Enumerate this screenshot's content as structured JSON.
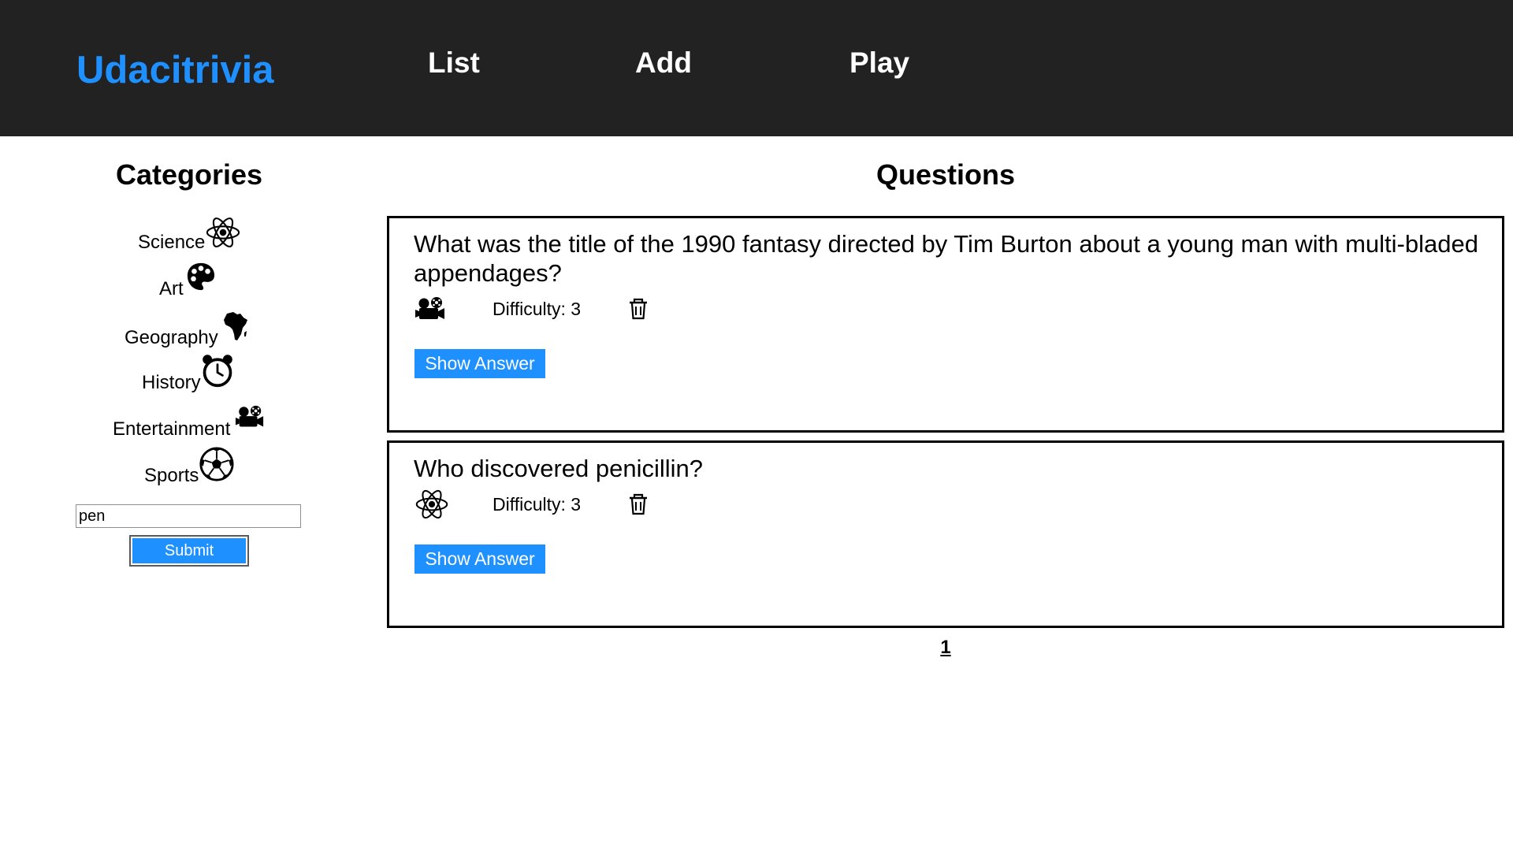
{
  "header": {
    "logo": "Udacitrivia",
    "nav": [
      "List",
      "Add",
      "Play"
    ]
  },
  "categories": {
    "heading": "Categories",
    "items": [
      {
        "label": "Science",
        "icon": "atom-icon"
      },
      {
        "label": "Art",
        "icon": "palette-icon"
      },
      {
        "label": "Geography",
        "icon": "africa-icon"
      },
      {
        "label": "History",
        "icon": "alarm-clock-icon"
      },
      {
        "label": "Entertainment",
        "icon": "film-camera-icon"
      },
      {
        "label": "Sports",
        "icon": "soccer-ball-icon"
      }
    ]
  },
  "search": {
    "value": "pen",
    "submit_label": "Submit"
  },
  "questions": {
    "heading": "Questions",
    "items": [
      {
        "text": "What was the title of the 1990 fantasy directed by Tim Burton about a young man with multi-bladed appendages?",
        "category_icon": "film-camera-icon",
        "difficulty": "Difficulty: 3",
        "show_answer": "Show Answer"
      },
      {
        "text": "Who discovered penicillin?",
        "category_icon": "atom-icon",
        "difficulty": "Difficulty: 3",
        "show_answer": "Show Answer"
      }
    ]
  },
  "pagination": {
    "current": "1"
  },
  "colors": {
    "header_bg": "#222222",
    "accent": "#1e90ff"
  }
}
